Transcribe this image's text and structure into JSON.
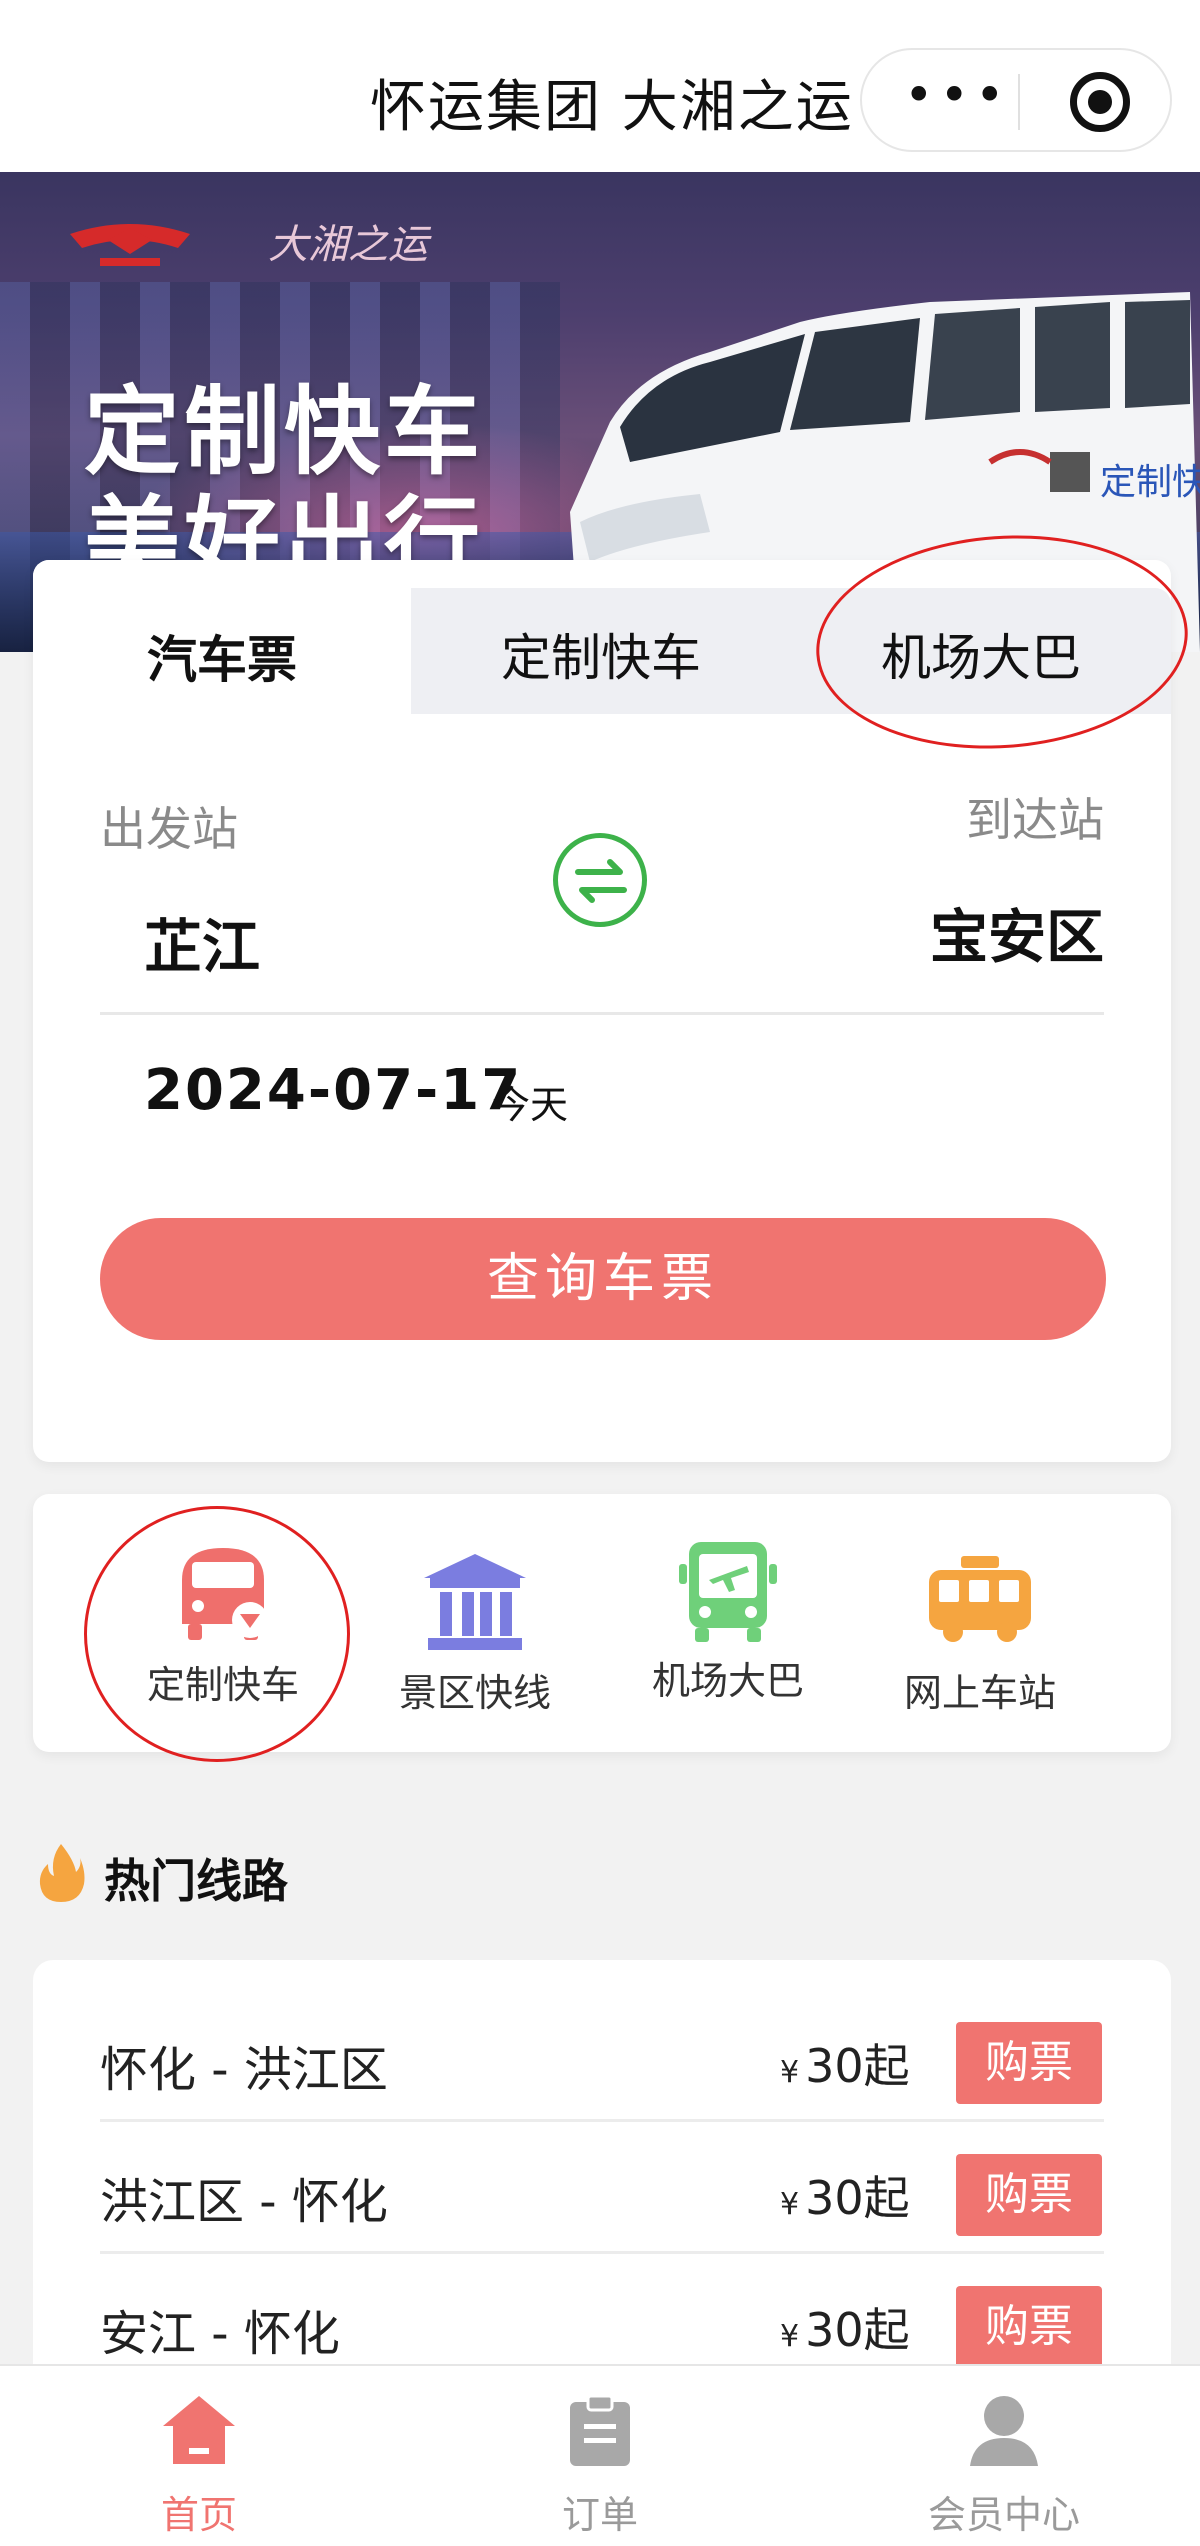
{
  "header": {
    "title": "怀运集团 大湘之运",
    "more_icon": "more-dots-icon",
    "close_icon": "target-icon"
  },
  "banner": {
    "line1": "定制快车",
    "line2": "美好出行",
    "script_text": "大湘之运",
    "van_text": "定制快车"
  },
  "tabs": [
    {
      "label": "汽车票",
      "active": true
    },
    {
      "label": "定制快车",
      "active": false
    },
    {
      "label": "机场大巴",
      "active": false
    }
  ],
  "search": {
    "from_label": "出发站",
    "to_label": "到达站",
    "from_city": "芷江",
    "to_city": "宝安区",
    "date": "2024-07-17",
    "date_hint": "今天",
    "query_button": "查询车票"
  },
  "services": [
    {
      "label": "定制快车",
      "icon": "custom-bus-icon",
      "color": "#ef6f6c"
    },
    {
      "label": "景区快线",
      "icon": "scenic-pavilion-icon",
      "color": "#7b7de0"
    },
    {
      "label": "机场大巴",
      "icon": "airport-bus-icon",
      "color": "#6fd07a"
    },
    {
      "label": "网上车站",
      "icon": "station-bus-icon",
      "color": "#f5a540"
    }
  ],
  "hot": {
    "title": "热门线路",
    "routes": [
      {
        "name": "怀化 - 洪江区",
        "currency": "¥",
        "price": "30起",
        "buy": "购票"
      },
      {
        "name": "洪江区 - 怀化",
        "currency": "¥",
        "price": "30起",
        "buy": "购票"
      },
      {
        "name": "安江 - 怀化",
        "currency": "¥",
        "price": "30起",
        "buy": "购票"
      }
    ]
  },
  "nav": [
    {
      "label": "首页",
      "icon": "home-icon",
      "active": true
    },
    {
      "label": "订单",
      "icon": "order-clipboard-icon",
      "active": false
    },
    {
      "label": "会员中心",
      "icon": "member-user-icon",
      "active": false
    }
  ],
  "colors": {
    "accent": "#f07470",
    "swap_green": "#3db24a",
    "annotation_red": "#e02020"
  }
}
